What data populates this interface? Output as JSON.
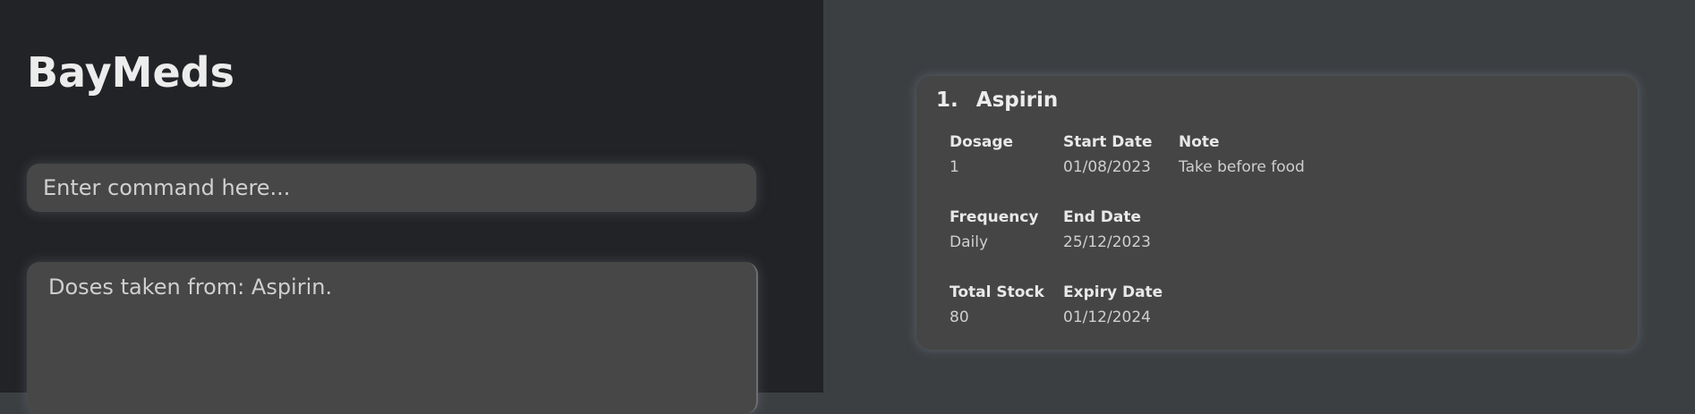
{
  "app": {
    "title": "BayMeds"
  },
  "command": {
    "placeholder": "Enter command here..."
  },
  "result": {
    "text": "Doses taken from: Aspirin."
  },
  "medication": {
    "index": "1.",
    "name": "Aspirin",
    "fields": {
      "dosage": {
        "label": "Dosage",
        "value": "1"
      },
      "start_date": {
        "label": "Start Date",
        "value": "01/08/2023"
      },
      "note": {
        "label": "Note",
        "value": "Take before food"
      },
      "frequency": {
        "label": "Frequency",
        "value": "Daily"
      },
      "end_date": {
        "label": "End Date",
        "value": "25/12/2023"
      },
      "total_stock": {
        "label": "Total Stock",
        "value": "80"
      },
      "expiry_date": {
        "label": "Expiry Date",
        "value": "01/12/2024"
      }
    }
  }
}
